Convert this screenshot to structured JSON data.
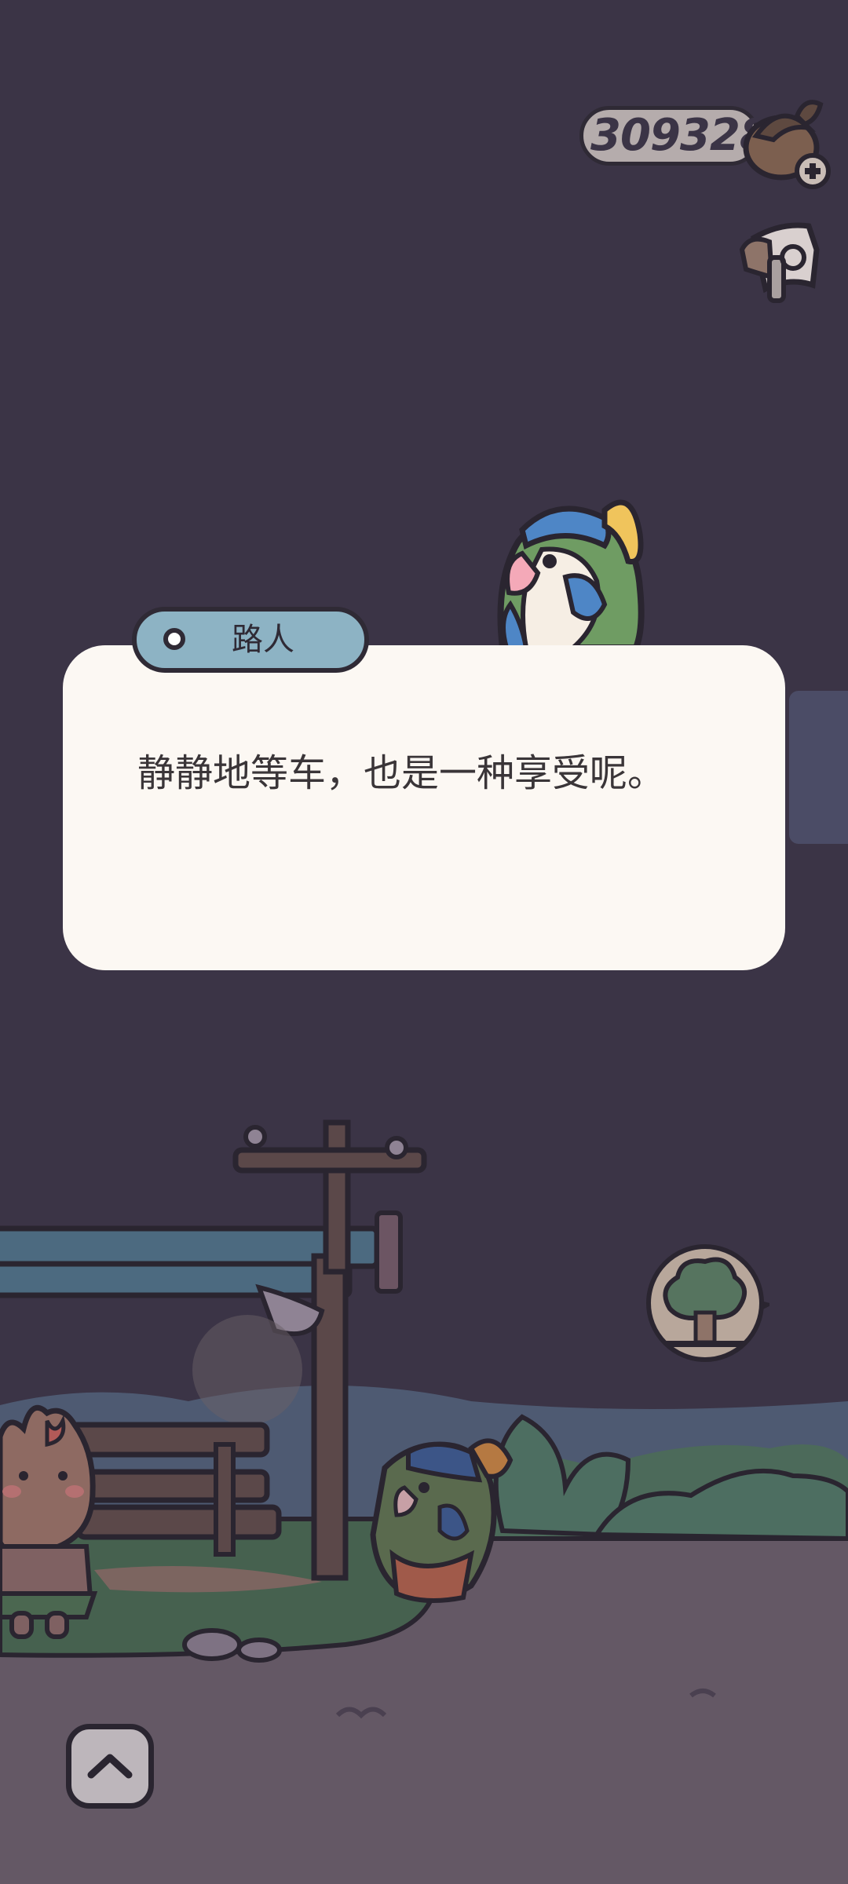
{
  "hud": {
    "currency_value": "309328",
    "currency_icon": "acorn-coin-icon",
    "add_icon": "plus-icon",
    "secondary_icon": "flag-icon"
  },
  "dialog": {
    "speaker": "路人",
    "text": "静静地等车，也是一种享受呢。"
  },
  "controls": {
    "map_icon": "tree-map-icon",
    "up_icon": "chevron-up-icon"
  },
  "colors": {
    "night_sky": "#3b3446",
    "ground": "#645865",
    "dialog_bg": "#fcf8f3",
    "speaker_tag": "#8db3c4",
    "outline": "#2f2a35"
  }
}
